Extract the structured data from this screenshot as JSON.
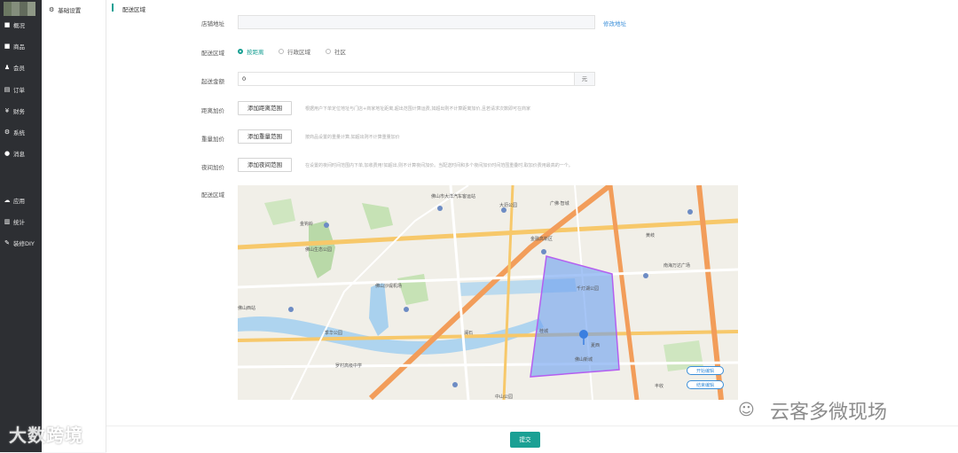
{
  "sidebar": {
    "items": [
      {
        "label": "概况",
        "icon": "square-icon"
      },
      {
        "label": "商品",
        "icon": "square-icon"
      },
      {
        "label": "会员",
        "icon": "users-icon"
      },
      {
        "label": "订单",
        "icon": "cart-icon"
      },
      {
        "label": "财务",
        "icon": "yen-icon"
      },
      {
        "label": "系统",
        "icon": "gear-icon"
      },
      {
        "label": "消息",
        "icon": "chat-icon"
      },
      {
        "label": "应用",
        "icon": "apps-icon"
      },
      {
        "label": "统计",
        "icon": "chart-icon"
      },
      {
        "label": "装修DIY",
        "icon": "brush-icon"
      }
    ]
  },
  "subnav": {
    "label": "基础设置",
    "icon": "gear-icon"
  },
  "page": {
    "title": "配送区域"
  },
  "form": {
    "store_address_label": "店铺地址",
    "store_address_value": "",
    "modify_address_link": "修改地址",
    "area_label": "配送区域",
    "area_options": [
      "按距离",
      "行政区域",
      "社区"
    ],
    "area_selected": "按距离",
    "min_amount_label": "起送金额",
    "min_amount_value": "0",
    "min_amount_unit": "元",
    "distance_label": "距离加价",
    "distance_button": "添加距离范围",
    "distance_hint": "根据用户下单定位地址与门店+商家地址距离,超出范围计算运费,如超出则不计算距离加价,且若请求次数即可在商家",
    "weight_label": "重量加价",
    "weight_button": "添加重量范围",
    "weight_hint": "按商品设置的重量计算,如超出则不计算重量加价",
    "night_label": "夜间加价",
    "night_button": "添加夜间范围",
    "night_hint": "在设置的夜间时间范围内下单,加收费用!如超出,则不计算夜间加价。当配送时间和多个夜间加价时间范围重叠时,取加价费用最高的一个。",
    "map_label": "配送区域"
  },
  "map": {
    "start_edit": "开始编辑",
    "end_edit": "结束编辑",
    "place_labels": [
      "佛山市大洋汽车客运站",
      "大沥公园",
      "金钩岭",
      "佛山生态公园",
      "黄岐",
      "广佛·智城",
      "佛山西站",
      "佛山沙堤机场",
      "澜石",
      "季华公园",
      "罗村高级中学",
      "中山公园",
      "千灯湖公园",
      "金融高新区",
      "南海万达广场",
      "桂城",
      "丰收",
      "夏西",
      "佛山新城"
    ]
  },
  "footer": {
    "submit": "提交"
  },
  "watermarks": {
    "left": "大数跨境",
    "right": "云客多微现场"
  },
  "colors": {
    "accent": "#1aa094",
    "sidebar": "#2d2f33",
    "link": "#3b8fd9",
    "polygon": "#6a9ff0"
  }
}
